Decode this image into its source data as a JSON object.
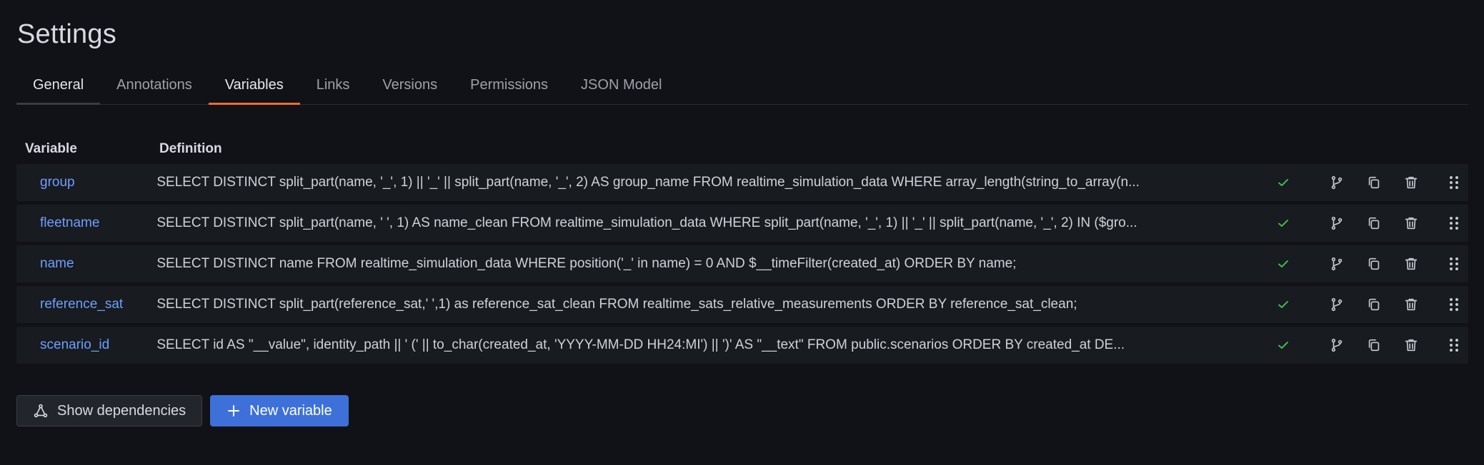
{
  "page": {
    "title": "Settings"
  },
  "tabs": [
    {
      "label": "General"
    },
    {
      "label": "Annotations"
    },
    {
      "label": "Variables"
    },
    {
      "label": "Links"
    },
    {
      "label": "Versions"
    },
    {
      "label": "Permissions"
    },
    {
      "label": "JSON Model"
    }
  ],
  "table": {
    "headers": {
      "variable": "Variable",
      "definition": "Definition"
    },
    "rows": [
      {
        "name": "group",
        "definition": "SELECT DISTINCT split_part(name, '_', 1) || '_' || split_part(name, '_', 2) AS group_name FROM realtime_simulation_data WHERE array_length(string_to_array(n...",
        "status": "ok"
      },
      {
        "name": "fleetname",
        "definition": "SELECT DISTINCT split_part(name, ' ', 1) AS name_clean FROM realtime_simulation_data WHERE split_part(name, '_', 1) || '_' || split_part(name, '_', 2) IN ($gro...",
        "status": "ok"
      },
      {
        "name": "name",
        "definition": "SELECT DISTINCT name FROM realtime_simulation_data WHERE position('_' in name) = 0 AND $__timeFilter(created_at) ORDER BY name;",
        "status": "ok"
      },
      {
        "name": "reference_sat",
        "definition": "SELECT DISTINCT split_part(reference_sat,' ',1) as reference_sat_clean FROM realtime_sats_relative_measurements ORDER BY reference_sat_clean;",
        "status": "ok"
      },
      {
        "name": "scenario_id",
        "definition": "SELECT id AS \"__value\", identity_path || ' (' || to_char(created_at, 'YYYY-MM-DD HH24:MI') || ')' AS \"__text\" FROM public.scenarios ORDER BY created_at DE...",
        "status": "ok"
      }
    ]
  },
  "footer": {
    "show_dependencies": "Show dependencies",
    "new_variable": "New variable"
  },
  "colors": {
    "accent": "#f06b2e",
    "link": "#6e9fff",
    "primary": "#3d71d9",
    "ok": "#3fb950"
  }
}
